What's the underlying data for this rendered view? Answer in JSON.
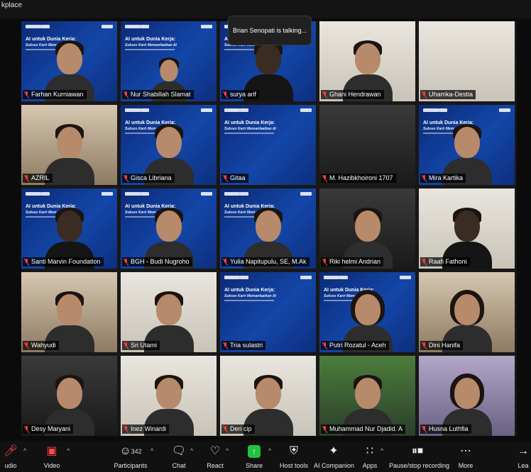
{
  "workspace_label": "kplace",
  "talking_banner": "Brian Senopati is talking...",
  "slide": {
    "title_line1": "AI untuk Dunia Kerja:",
    "subtitle": "Sukses Karir Memanfaatkan AI"
  },
  "participants": [
    {
      "name": "Farhan Kurniawan",
      "bg": "slide",
      "person": "normal"
    },
    {
      "name": "Nur Shabillah Slamat",
      "bg": "slide",
      "person": "small"
    },
    {
      "name": "surya arif",
      "bg": "slide",
      "person": "dark"
    },
    {
      "name": "Ghani Hendrawan",
      "bg": "room-light",
      "person": "normal"
    },
    {
      "name": "Uhamka-Destia",
      "bg": "room-light",
      "person": "none"
    },
    {
      "name": "AZRIL",
      "bg": "room-warm",
      "person": "normal"
    },
    {
      "name": "Gisca Libriana",
      "bg": "slide",
      "person": "normal"
    },
    {
      "name": "Gitaa",
      "bg": "slide",
      "person": "none"
    },
    {
      "name": "M. Hazibkhoironi 1707",
      "bg": "room-dark",
      "person": "none"
    },
    {
      "name": "Mira Kartika",
      "bg": "slide",
      "person": "normal"
    },
    {
      "name": "Santi Marvin Foundation",
      "bg": "slide",
      "person": "dark"
    },
    {
      "name": "BGH - Budi Nugroho",
      "bg": "slide",
      "person": "normal"
    },
    {
      "name": "Yulia Napitupulu, SE, M.Ak",
      "bg": "slide",
      "person": "normal"
    },
    {
      "name": "Riki helmi Andrian",
      "bg": "room-dark",
      "person": "normal"
    },
    {
      "name": "Raafi Fathoni",
      "bg": "room-light",
      "person": "dark"
    },
    {
      "name": "Wahyudi",
      "bg": "room-warm",
      "person": "normal"
    },
    {
      "name": "Sri Utami",
      "bg": "room-light",
      "person": "normal"
    },
    {
      "name": "Tria sulastri",
      "bg": "slide",
      "person": "none"
    },
    {
      "name": "Putri Rozatul - Aceh",
      "bg": "slide",
      "person": "hijab"
    },
    {
      "name": "Dini Hanifa",
      "bg": "room-warm",
      "person": "hijab"
    },
    {
      "name": "Desy Maryani",
      "bg": "room-dark",
      "person": "normal"
    },
    {
      "name": "Inez Winardi",
      "bg": "room-light",
      "person": "normal"
    },
    {
      "name": "Deri cip",
      "bg": "room-light",
      "person": "normal"
    },
    {
      "name": "Muhammad Nur Djadid. A",
      "bg": "room-green",
      "person": "normal"
    },
    {
      "name": "Husna Luthfia",
      "bg": "room-lilac",
      "person": "hijab"
    }
  ],
  "toolbar": {
    "audio_label": "udio",
    "video_label": "Video",
    "participants_label": "Participants",
    "participants_count": "342",
    "chat_label": "Chat",
    "react_label": "React",
    "share_label": "Share",
    "host_tools_label": "Host tools",
    "ai_companion_label": "AI Companion",
    "apps_label": "Apps",
    "recording_label": "Pause/stop recording",
    "more_label": "More",
    "leave_label": "Lea"
  },
  "colors": {
    "slide_blue": "#1346a8",
    "muted_red": "#ff3d3d",
    "share_green": "#21c23e"
  }
}
